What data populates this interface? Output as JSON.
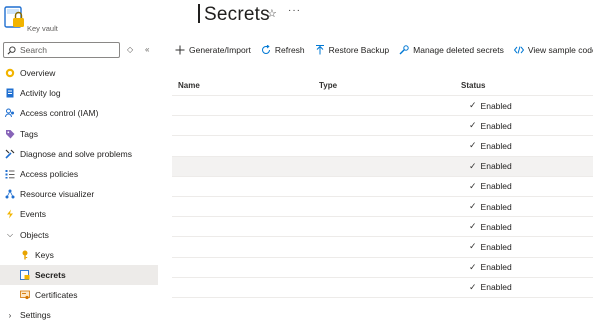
{
  "header": {
    "resource_type": "Key vault",
    "title": "Secrets",
    "favorite_icon": "star-outline-icon",
    "more_icon": "ellipsis-icon"
  },
  "sidebar": {
    "search_placeholder": "Search",
    "items": [
      {
        "label": "Overview",
        "icon": "overview-icon"
      },
      {
        "label": "Activity log",
        "icon": "activity-log-icon"
      },
      {
        "label": "Access control (IAM)",
        "icon": "people-icon"
      },
      {
        "label": "Tags",
        "icon": "tag-icon"
      },
      {
        "label": "Diagnose and solve problems",
        "icon": "wrench-icon"
      },
      {
        "label": "Access policies",
        "icon": "list-icon"
      },
      {
        "label": "Resource visualizer",
        "icon": "network-icon"
      },
      {
        "label": "Events",
        "icon": "lightning-icon"
      },
      {
        "label": "Objects",
        "icon": "chevron-down-icon",
        "expanded": true
      },
      {
        "label": "Keys",
        "icon": "key-icon",
        "child": true
      },
      {
        "label": "Secrets",
        "icon": "secret-icon",
        "child": true,
        "active": true
      },
      {
        "label": "Certificates",
        "icon": "certificate-icon",
        "child": true
      },
      {
        "label": "Settings",
        "icon": "chevron-right-icon"
      }
    ]
  },
  "toolbar": {
    "generate_label": "Generate/Import",
    "refresh_label": "Refresh",
    "restore_label": "Restore Backup",
    "manage_deleted_label": "Manage deleted secrets",
    "sample_code_label": "View sample code"
  },
  "table": {
    "columns": [
      "Name",
      "Type",
      "Status"
    ],
    "rows": [
      {
        "name": "",
        "type": "",
        "status": "Enabled"
      },
      {
        "name": "",
        "type": "",
        "status": "Enabled"
      },
      {
        "name": "",
        "type": "",
        "status": "Enabled"
      },
      {
        "name": "",
        "type": "",
        "status": "Enabled"
      },
      {
        "name": "",
        "type": "",
        "status": "Enabled"
      },
      {
        "name": "",
        "type": "",
        "status": "Enabled"
      },
      {
        "name": "",
        "type": "",
        "status": "Enabled"
      },
      {
        "name": "",
        "type": "",
        "status": "Enabled"
      },
      {
        "name": "",
        "type": "",
        "status": "Enabled"
      },
      {
        "name": "",
        "type": "",
        "status": "Enabled"
      }
    ]
  },
  "colors": {
    "accent": "#0078d4",
    "active_nav_bg": "#edebe9",
    "row_highlight": "#f3f2f1",
    "key_gold": "#e8a400"
  }
}
